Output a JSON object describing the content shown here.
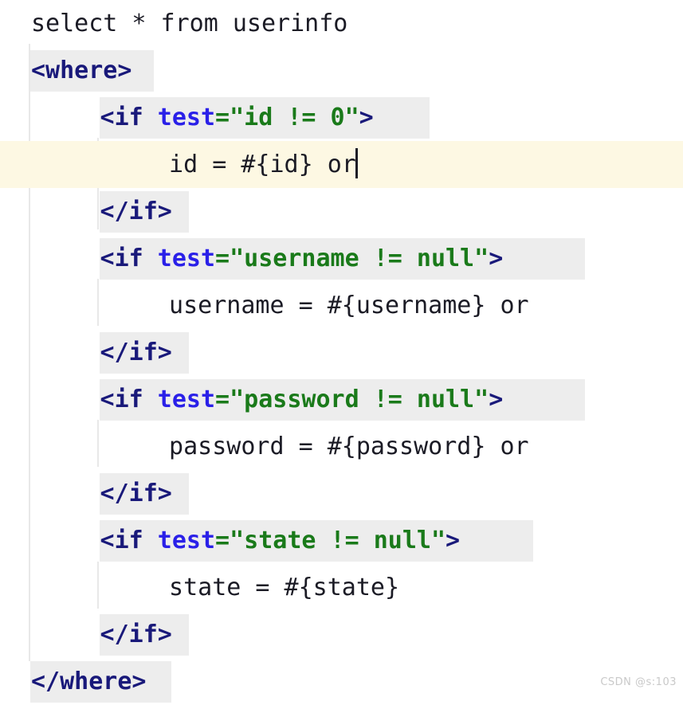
{
  "editor": {
    "language": "xml",
    "colors": {
      "background": "#ffffff",
      "current_line": "#fdf8e3",
      "tag_block_highlight": "#ededed",
      "indent_guide": "#e8e8e8",
      "tag_name": "#19197a",
      "attribute_name": "#2a20e8",
      "attribute_value": "#1a7a1a",
      "plain_text": "#1b1b25",
      "watermark": "#c9c9c9"
    },
    "caret_line": 4,
    "lines": [
      {
        "n": 1,
        "indent": 0,
        "highlight": "none",
        "text": "select * from userinfo",
        "tokens": [
          {
            "kind": "plain",
            "text": "select * from userinfo"
          }
        ]
      },
      {
        "n": 2,
        "indent": 0,
        "highlight": "tag",
        "text": "<where>",
        "tokens": [
          {
            "kind": "tag",
            "text": "<where>"
          }
        ]
      },
      {
        "n": 3,
        "indent": 1,
        "highlight": "tag",
        "text": "<if test=\"id != 0\">",
        "tokens": [
          {
            "kind": "tag",
            "text": "<if "
          },
          {
            "kind": "attr",
            "text": "test"
          },
          {
            "kind": "str",
            "text": "=\"id != 0\""
          },
          {
            "kind": "tag",
            "text": ">"
          }
        ]
      },
      {
        "n": 4,
        "indent": 2,
        "highlight": "current",
        "text": "id = #{id} or",
        "caret_after": true,
        "tokens": [
          {
            "kind": "plain",
            "text": "id = #{id} or"
          }
        ]
      },
      {
        "n": 5,
        "indent": 1,
        "highlight": "tag",
        "text": "</if>",
        "tokens": [
          {
            "kind": "tag",
            "text": "</if>"
          }
        ]
      },
      {
        "n": 6,
        "indent": 1,
        "highlight": "tag",
        "text": "<if test=\"username != null\">",
        "tokens": [
          {
            "kind": "tag",
            "text": "<if "
          },
          {
            "kind": "attr",
            "text": "test"
          },
          {
            "kind": "str",
            "text": "=\"username != null\""
          },
          {
            "kind": "tag",
            "text": ">"
          }
        ]
      },
      {
        "n": 7,
        "indent": 2,
        "highlight": "none",
        "text": "username = #{username} or",
        "tokens": [
          {
            "kind": "plain",
            "text": "username = #{username} or"
          }
        ]
      },
      {
        "n": 8,
        "indent": 1,
        "highlight": "tag",
        "text": "</if>",
        "tokens": [
          {
            "kind": "tag",
            "text": "</if>"
          }
        ]
      },
      {
        "n": 9,
        "indent": 1,
        "highlight": "tag",
        "text": "<if test=\"password != null\">",
        "tokens": [
          {
            "kind": "tag",
            "text": "<if "
          },
          {
            "kind": "attr",
            "text": "test"
          },
          {
            "kind": "str",
            "text": "=\"password != null\""
          },
          {
            "kind": "tag",
            "text": ">"
          }
        ]
      },
      {
        "n": 10,
        "indent": 2,
        "highlight": "none",
        "text": "password = #{password} or",
        "tokens": [
          {
            "kind": "plain",
            "text": "password = #{password} or"
          }
        ]
      },
      {
        "n": 11,
        "indent": 1,
        "highlight": "tag",
        "text": "</if>",
        "tokens": [
          {
            "kind": "tag",
            "text": "</if>"
          }
        ]
      },
      {
        "n": 12,
        "indent": 1,
        "highlight": "tag",
        "text": "<if test=\"state != null\">",
        "tokens": [
          {
            "kind": "tag",
            "text": "<if "
          },
          {
            "kind": "attr",
            "text": "test"
          },
          {
            "kind": "str",
            "text": "=\"state != null\""
          },
          {
            "kind": "tag",
            "text": ">"
          }
        ]
      },
      {
        "n": 13,
        "indent": 2,
        "highlight": "none",
        "text": "state = #{state}",
        "tokens": [
          {
            "kind": "plain",
            "text": "state = #{state}"
          }
        ]
      },
      {
        "n": 14,
        "indent": 1,
        "highlight": "tag",
        "text": "</if>",
        "tokens": [
          {
            "kind": "tag",
            "text": "</if>"
          }
        ]
      },
      {
        "n": 15,
        "indent": 0,
        "highlight": "tag",
        "text": "</where>",
        "tokens": [
          {
            "kind": "tag",
            "text": "</where>"
          }
        ]
      }
    ]
  },
  "watermark": {
    "text": "CSDN @s:103"
  }
}
